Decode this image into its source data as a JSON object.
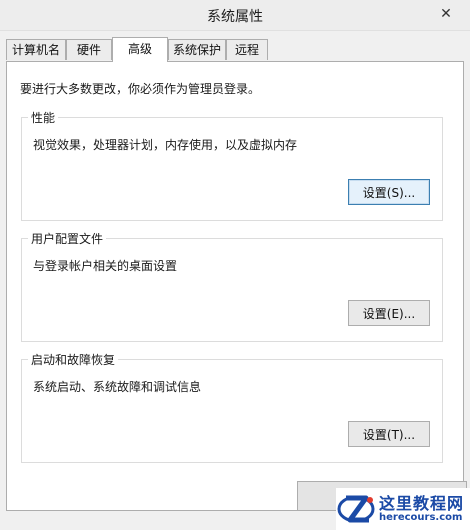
{
  "window": {
    "title": "系统属性",
    "close_glyph": "✕"
  },
  "tabs": [
    {
      "label": "计算机名",
      "active": false
    },
    {
      "label": "硬件",
      "active": false
    },
    {
      "label": "高级",
      "active": true
    },
    {
      "label": "系统保护",
      "active": false
    },
    {
      "label": "远程",
      "active": false
    }
  ],
  "admin_note": "要进行大多数更改，你必须作为管理员登录。",
  "groups": {
    "performance": {
      "title": "性能",
      "description": "视觉效果，处理器计划，内存使用，以及虚拟内存",
      "button_label": "设置(S)..."
    },
    "user_profiles": {
      "title": "用户配置文件",
      "description": "与登录帐户相关的桌面设置",
      "button_label": "设置(E)..."
    },
    "startup_recovery": {
      "title": "启动和故障恢复",
      "description": "系统启动、系统故障和调试信息",
      "button_label": "设置(T)..."
    }
  },
  "watermark": {
    "title": "这里教程网",
    "url": "herecours.com"
  },
  "colors": {
    "accent": "#3c7fb1",
    "watermark": "#1b4aa6",
    "panel": "#ffffff",
    "chrome": "#f0f0f0"
  }
}
